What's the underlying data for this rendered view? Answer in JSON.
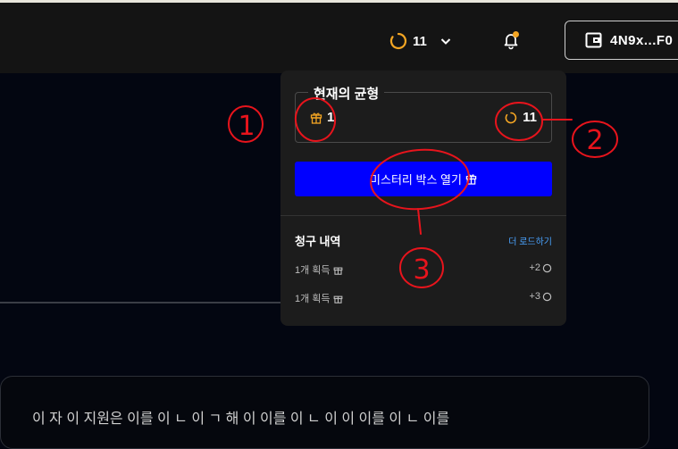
{
  "header": {
    "points_value": "11",
    "wallet_address": "4N9x...F0"
  },
  "balance_panel": {
    "title": "현재의 균형",
    "mystery_box_count": "1",
    "points_count": "11",
    "open_button_label": "미스터리 박스 열기",
    "claims_title": "청구 내역",
    "load_more_label": "더 로드하기",
    "claims": [
      {
        "label": "1개 획득",
        "amount": "+2"
      },
      {
        "label": "1개 획득",
        "amount": "+3"
      }
    ]
  },
  "annotations": [
    "1",
    "2",
    "3"
  ],
  "background_text": "이 자 이 지원은 이를 이 ㄴ 이 ㄱ 해 이 이를 이 ㄴ 이 이 이를 이 ㄴ 이를",
  "colors": {
    "button_blue": "#0000ff",
    "accent_orange": "#f5a623",
    "annotation_red": "#e8141c",
    "link_blue": "#4aa3ff"
  }
}
